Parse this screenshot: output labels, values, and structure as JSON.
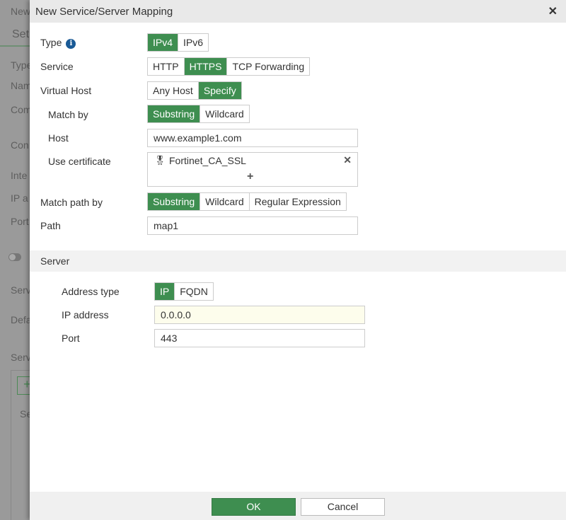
{
  "background": {
    "fragments": [
      "New",
      "Set",
      "Type",
      "Nam",
      "Com",
      "Con",
      "Inte",
      "IP a",
      "Port",
      "Serv",
      "Defa",
      "Serv",
      "Se"
    ],
    "add_label": "+"
  },
  "dialog": {
    "title": "New Service/Server Mapping",
    "close_icon": "close-icon"
  },
  "form": {
    "type": {
      "label": "Type",
      "options": [
        "IPv4",
        "IPv6"
      ],
      "selected": "IPv4"
    },
    "service": {
      "label": "Service",
      "options": [
        "HTTP",
        "HTTPS",
        "TCP Forwarding"
      ],
      "selected": "HTTPS"
    },
    "virtual_host": {
      "label": "Virtual Host",
      "options": [
        "Any Host",
        "Specify"
      ],
      "selected": "Specify"
    },
    "match_by": {
      "label": "Match by",
      "options": [
        "Substring",
        "Wildcard"
      ],
      "selected": "Substring"
    },
    "host": {
      "label": "Host",
      "value": "www.example1.com"
    },
    "certificate": {
      "label": "Use certificate",
      "value": "Fortinet_CA_SSL",
      "add": "+"
    },
    "match_path_by": {
      "label": "Match path by",
      "options": [
        "Substring",
        "Wildcard",
        "Regular Expression"
      ],
      "selected": "Substring"
    },
    "path": {
      "label": "Path",
      "value": "map1"
    }
  },
  "server": {
    "title": "Server",
    "address_type": {
      "label": "Address type",
      "options": [
        "IP",
        "FQDN"
      ],
      "selected": "IP"
    },
    "ip_address": {
      "label": "IP address",
      "value": "0.0.0.0"
    },
    "port": {
      "label": "Port",
      "value": "443"
    }
  },
  "footer": {
    "ok": "OK",
    "cancel": "Cancel"
  },
  "colors": {
    "accent": "#3e8e50",
    "highlight_input": "#fdfdec"
  }
}
